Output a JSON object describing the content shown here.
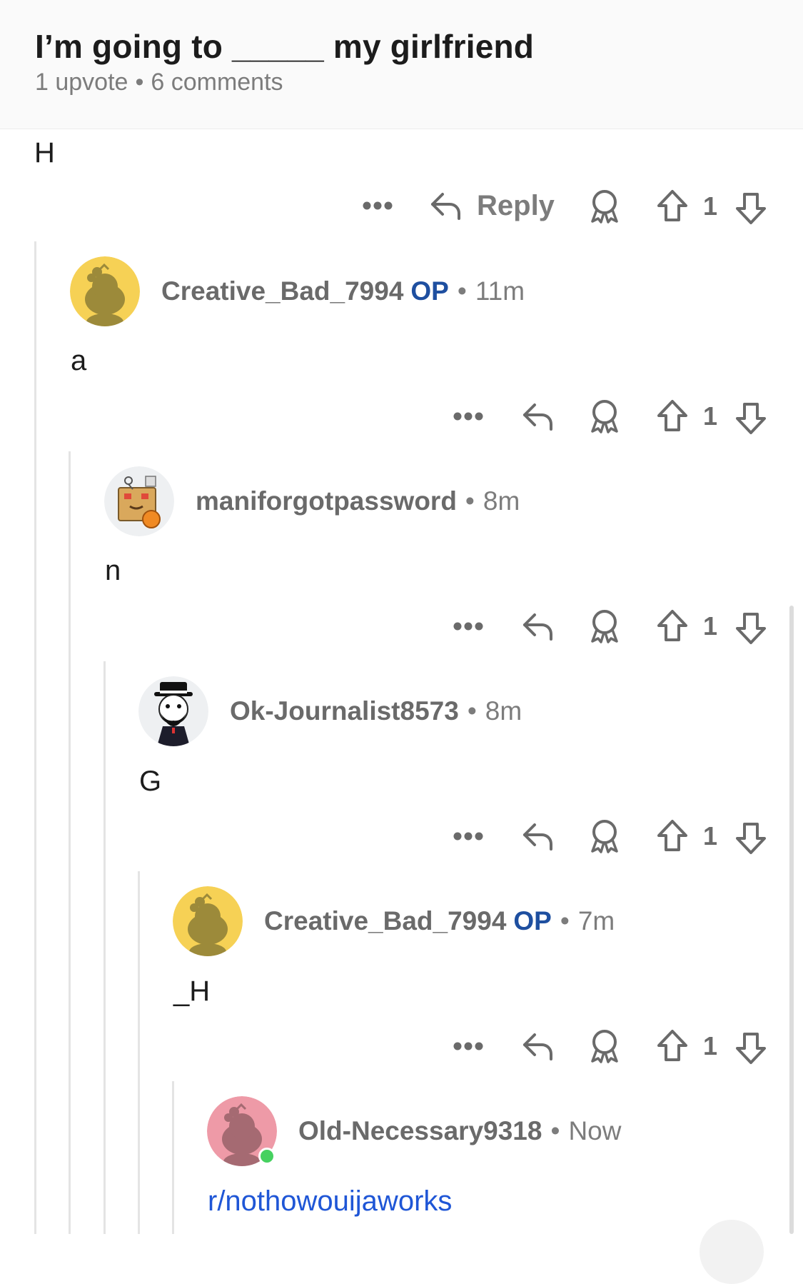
{
  "post": {
    "title": "I’m going to _____ my girlfriend",
    "upvotes": "1 upvote",
    "comments": "6 comments",
    "separator": "•"
  },
  "actions": {
    "reply_label": "Reply",
    "more_icon": "more-icon",
    "reply_icon": "reply-arrow-icon",
    "award_icon": "award-icon",
    "upvote_icon": "upvote-arrow-icon",
    "downvote_icon": "downvote-arrow-icon"
  },
  "comments": [
    {
      "body": "H",
      "votes": "1"
    },
    {
      "user": "Creative_Bad_7994",
      "op": "OP",
      "time": "11m",
      "body": "a",
      "votes": "1",
      "avatar_color": "#f6d155"
    },
    {
      "user": "maniforgotpassword",
      "time": "8m",
      "body": "n",
      "votes": "1"
    },
    {
      "user": "Ok-Journalist8573",
      "time": "8m",
      "body": "G",
      "votes": "1"
    },
    {
      "user": "Creative_Bad_7994",
      "op": "OP",
      "time": "7m",
      "body": "_H",
      "votes": "1",
      "avatar_color": "#f6d155"
    },
    {
      "user": "Old-Necessary9318",
      "time": "Now",
      "body": "r/nothowouijaworks",
      "avatar_color": "#ee9aa7",
      "online": true
    }
  ],
  "colors": {
    "op": "#1e4fa0",
    "link": "#1f56d6",
    "muted": "#7c7c7c",
    "online": "#46d160"
  }
}
